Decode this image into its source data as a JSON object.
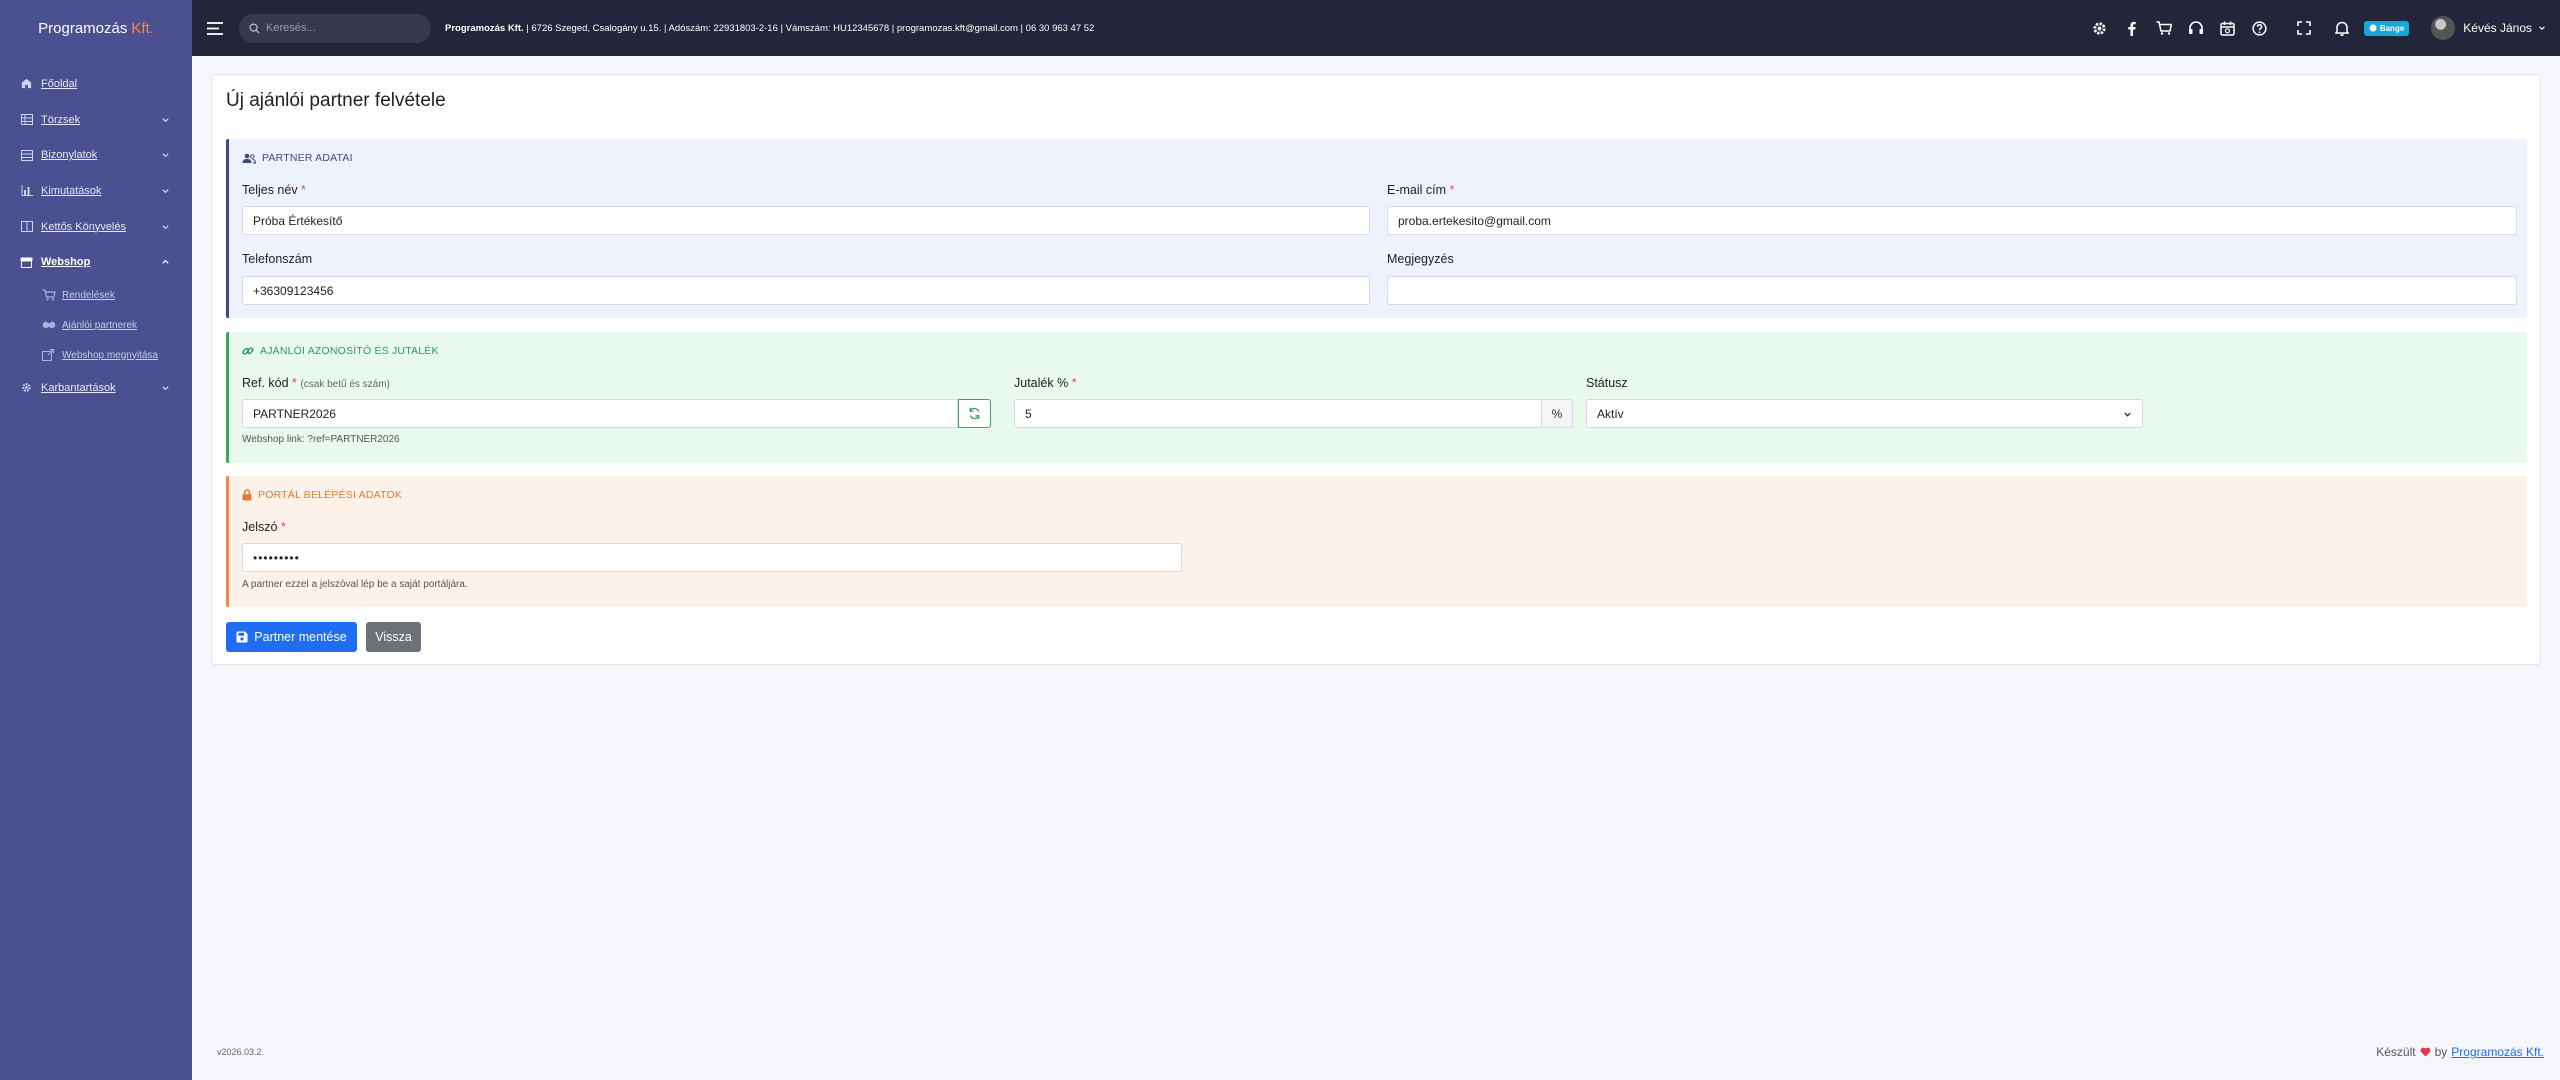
{
  "brand": {
    "name": "Programozás",
    "suffix": "Kft."
  },
  "sidebar": {
    "items": [
      {
        "label": "Főoldal"
      },
      {
        "label": "Törzsek"
      },
      {
        "label": "Bizonylatok"
      },
      {
        "label": "Kimutatások"
      },
      {
        "label": "Kettős Könyvelés"
      },
      {
        "label": "Webshop"
      },
      {
        "label": "Karbantartások"
      }
    ],
    "webshop_sub": [
      {
        "label": "Rendelések"
      },
      {
        "label": "Ajánlói partnerek"
      },
      {
        "label": "Webshop megnyitása"
      }
    ]
  },
  "topbar": {
    "search_placeholder": "Keresés...",
    "company_name": "Programozás Kft.",
    "company_details": " | 6726 Szeged, Csalogány u.15. | Adószám: 22931803-2-16 | Vámszám: HU12345678 | programozas.kft@gmail.com | 06 30 963 47 52",
    "badge": "Bange",
    "user_name": "Kévés János"
  },
  "page": {
    "title": "Új ajánlói partner felvétele"
  },
  "partner_section": {
    "heading": "PARTNER ADATAI",
    "full_name_label": "Teljes név",
    "full_name_value": "Próba Értékesítő",
    "email_label": "E-mail cím",
    "email_value": "proba.ertekesito@gmail.com",
    "phone_label": "Telefonszám",
    "phone_value": "+36309123456",
    "note_label": "Megjegyzés",
    "note_value": "",
    "required_mark": "*"
  },
  "referral_section": {
    "heading": "AJÁNLÓI AZONOSÍTÓ ÉS JUTALÉK",
    "ref_label": "Ref. kód",
    "ref_hint": "(csak betű és szám)",
    "ref_value": "PARTNER2026",
    "webshop_link": "Webshop link: ?ref=PARTNER2026",
    "commission_label": "Jutalék %",
    "commission_value": "5",
    "commission_suffix": "%",
    "status_label": "Státusz",
    "status_value": "Aktív"
  },
  "portal_section": {
    "heading": "PORTÁL BELÉPÉSI ADATOK",
    "password_label": "Jelszó",
    "password_value": "•••••••••",
    "password_help": "A partner ezzel a jelszóval lép be a saját portáljára."
  },
  "actions": {
    "save_label": "Partner mentése",
    "back_label": "Vissza"
  },
  "footer": {
    "version": "v2026.03.2.",
    "made_prefix": "Készült",
    "made_by": "by",
    "made_link": "Programozás Kft."
  },
  "colors": {
    "sidebar": "#4a5090",
    "topbar": "#23263a",
    "primary": "#1e6df2",
    "accent_orange": "#f08a4b",
    "accent_green": "#3ca566"
  }
}
